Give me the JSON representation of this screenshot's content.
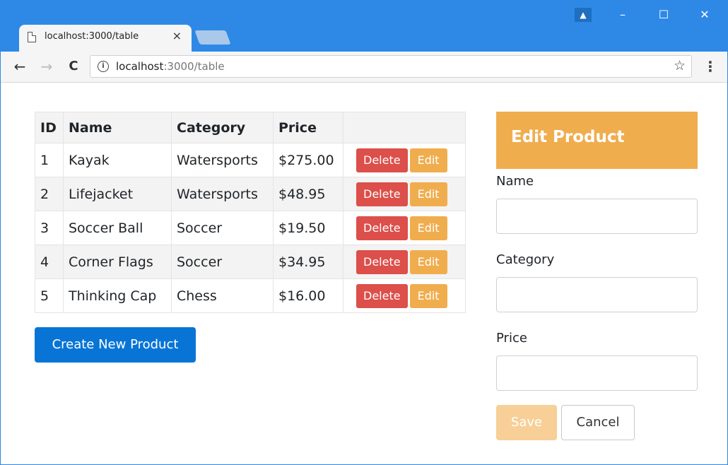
{
  "browser": {
    "tab_title": "localhost:3000/table",
    "tab_close": "×",
    "url_host": "localhost",
    "url_path": ":3000/table",
    "back_icon": "←",
    "forward_icon": "→",
    "reload_icon": "C",
    "info_icon": "i",
    "star_icon": "☆",
    "menu_icon": "⋮",
    "user_icon": "▲",
    "minimize_icon": "–",
    "maximize_icon": "☐",
    "close_icon": "✕"
  },
  "table": {
    "headers": [
      "ID",
      "Name",
      "Category",
      "Price",
      ""
    ],
    "rows": [
      {
        "id": "1",
        "name": "Kayak",
        "category": "Watersports",
        "price": "$275.00"
      },
      {
        "id": "2",
        "name": "Lifejacket",
        "category": "Watersports",
        "price": "$48.95"
      },
      {
        "id": "3",
        "name": "Soccer Ball",
        "category": "Soccer",
        "price": "$19.50"
      },
      {
        "id": "4",
        "name": "Corner Flags",
        "category": "Soccer",
        "price": "$34.95"
      },
      {
        "id": "5",
        "name": "Thinking Cap",
        "category": "Chess",
        "price": "$16.00"
      }
    ],
    "delete_label": "Delete",
    "edit_label": "Edit"
  },
  "create_button": "Create New Product",
  "edit_form": {
    "title": "Edit Product",
    "fields": [
      {
        "label": "Name",
        "value": ""
      },
      {
        "label": "Category",
        "value": ""
      },
      {
        "label": "Price",
        "value": ""
      }
    ],
    "save_label": "Save",
    "cancel_label": "Cancel"
  },
  "colors": {
    "titlebar": "#2e89e6",
    "primary": "#0875d6",
    "danger": "#dc4f4a",
    "warning": "#f0ad4e"
  }
}
